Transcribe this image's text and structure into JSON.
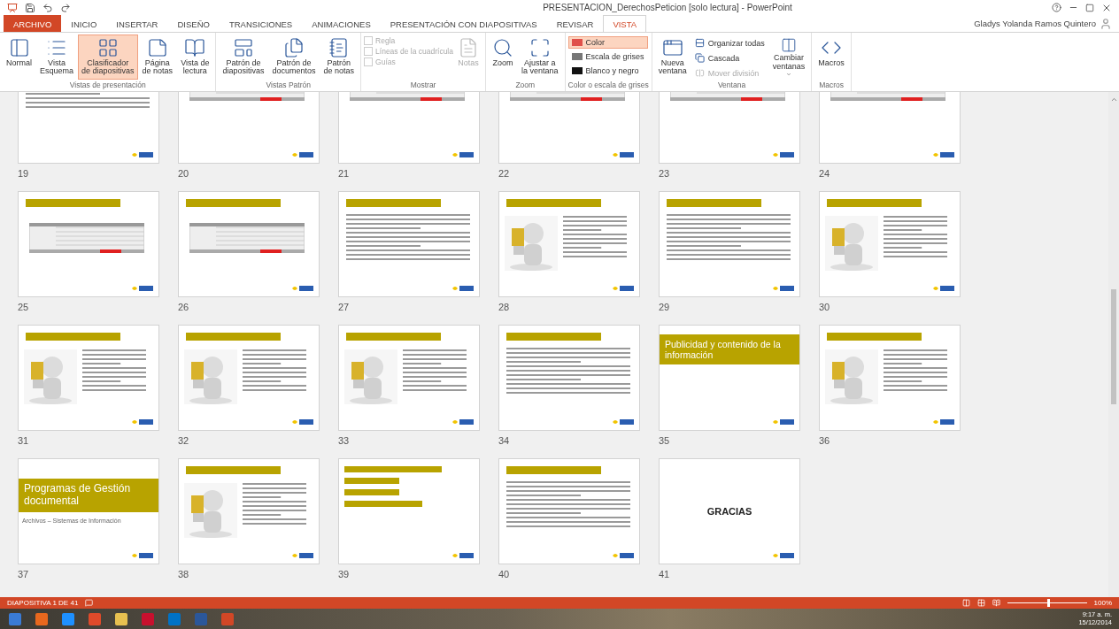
{
  "window": {
    "title": "PRESENTACION_DerechosPeticion [solo lectura] - PowerPoint",
    "user": "Gladys Yolanda Ramos Quintero"
  },
  "tabs": [
    {
      "label": "ARCHIVO",
      "kind": "file",
      "selected": false
    },
    {
      "label": "INICIO",
      "kind": "tab",
      "selected": false
    },
    {
      "label": "INSERTAR",
      "kind": "tab",
      "selected": false
    },
    {
      "label": "DISEÑO",
      "kind": "tab",
      "selected": false
    },
    {
      "label": "TRANSICIONES",
      "kind": "tab",
      "selected": false
    },
    {
      "label": "ANIMACIONES",
      "kind": "tab",
      "selected": false
    },
    {
      "label": "PRESENTACIÓN CON DIAPOSITIVAS",
      "kind": "tab",
      "selected": false
    },
    {
      "label": "REVISAR",
      "kind": "tab",
      "selected": false
    },
    {
      "label": "VISTA",
      "kind": "tab",
      "selected": true
    }
  ],
  "ribbon": [
    {
      "label": "Vistas de presentación",
      "items": [
        {
          "kind": "large",
          "label": "Normal",
          "selected": false,
          "disabled": false
        },
        {
          "kind": "large",
          "label": "Vista\nEsquema",
          "selected": false,
          "disabled": false
        },
        {
          "kind": "large",
          "label": "Clasificador\nde diapositivas",
          "selected": true,
          "disabled": false
        },
        {
          "kind": "large",
          "label": "Página\nde notas",
          "selected": false,
          "disabled": false
        },
        {
          "kind": "large",
          "label": "Vista de\nlectura",
          "selected": false,
          "disabled": false
        }
      ]
    },
    {
      "label": "Vistas Patrón",
      "items": [
        {
          "kind": "large",
          "label": "Patrón de\ndiapositivas",
          "selected": false,
          "disabled": false
        },
        {
          "kind": "large",
          "label": "Patrón de\ndocumentos",
          "selected": false,
          "disabled": false
        },
        {
          "kind": "large",
          "label": "Patrón\nde notas",
          "selected": false,
          "disabled": false
        }
      ]
    },
    {
      "label": "Mostrar",
      "items": [
        {
          "kind": "check",
          "label": "Regla",
          "checked": false,
          "disabled": true
        },
        {
          "kind": "check",
          "label": "Líneas de la cuadrícula",
          "checked": false,
          "disabled": true
        },
        {
          "kind": "check",
          "label": "Guías",
          "checked": false,
          "disabled": true
        },
        {
          "kind": "large",
          "label": "Notas",
          "selected": false,
          "disabled": true
        }
      ]
    },
    {
      "label": "Zoom",
      "items": [
        {
          "kind": "large",
          "label": "Zoom",
          "selected": false,
          "disabled": false
        },
        {
          "kind": "large",
          "label": "Ajustar a\nla ventana",
          "selected": false,
          "disabled": false
        }
      ]
    },
    {
      "label": "Color o escala de grises",
      "items": [
        {
          "kind": "small",
          "label": "Color",
          "selected": true,
          "disabled": false
        },
        {
          "kind": "small",
          "label": "Escala de grises",
          "selected": false,
          "disabled": false
        },
        {
          "kind": "small",
          "label": "Blanco y negro",
          "selected": false,
          "disabled": false
        }
      ]
    },
    {
      "label": "Ventana",
      "items": [
        {
          "kind": "large",
          "label": "Nueva\nventana",
          "selected": false,
          "disabled": false
        },
        {
          "kind": "small",
          "label": "Organizar todas",
          "selected": false,
          "disabled": false
        },
        {
          "kind": "small",
          "label": "Cascada",
          "selected": false,
          "disabled": false
        },
        {
          "kind": "small",
          "label": "Mover división",
          "selected": false,
          "disabled": true
        },
        {
          "kind": "menu",
          "label": "Cambiar\nventanas",
          "selected": false,
          "disabled": false
        }
      ]
    },
    {
      "label": "Macros",
      "items": [
        {
          "kind": "large",
          "label": "Macros",
          "selected": false,
          "disabled": false
        }
      ]
    }
  ],
  "slides": [
    {
      "number": "19",
      "kind": "text",
      "header": false
    },
    {
      "number": "20",
      "kind": "table",
      "header": false
    },
    {
      "number": "21",
      "kind": "table",
      "header": false
    },
    {
      "number": "22",
      "kind": "table",
      "header": false
    },
    {
      "number": "23",
      "kind": "table",
      "header": false
    },
    {
      "number": "24",
      "kind": "table",
      "header": false
    },
    {
      "number": "25",
      "kind": "table",
      "header": true
    },
    {
      "number": "26",
      "kind": "table",
      "header": true
    },
    {
      "number": "27",
      "kind": "text",
      "header": true
    },
    {
      "number": "28",
      "header": true
    },
    {
      "number": "29",
      "kind": "text",
      "header": true
    },
    {
      "number": "30",
      "header": true
    },
    {
      "number": "31",
      "header": true
    },
    {
      "number": "32",
      "header": true
    },
    {
      "number": "33",
      "header": true
    },
    {
      "number": "34",
      "kind": "text",
      "header": true
    },
    {
      "number": "35",
      "kind": "title",
      "header": false,
      "title": "Publicidad y  contenido de la información"
    },
    {
      "number": "36",
      "header": true
    },
    {
      "number": "37",
      "kind": "title",
      "header": false,
      "title": "Programas de Gestión documental",
      "subtitle": "Archivos – Sistemas de Información"
    },
    {
      "number": "38",
      "header": true
    },
    {
      "number": "39",
      "kind": "labels",
      "header": false
    },
    {
      "number": "40",
      "kind": "text",
      "header": true
    },
    {
      "number": "41",
      "kind": "closing",
      "header": false,
      "title": "GRACIAS"
    }
  ],
  "status_bar": {
    "slide_info": "DIAPOSITIVA 1 DE 41",
    "zoom": {
      "level": 0.5,
      "reading": "100%"
    }
  },
  "taskbar": {
    "time": "9:17 a. m.",
    "date": "15/12/2014"
  }
}
